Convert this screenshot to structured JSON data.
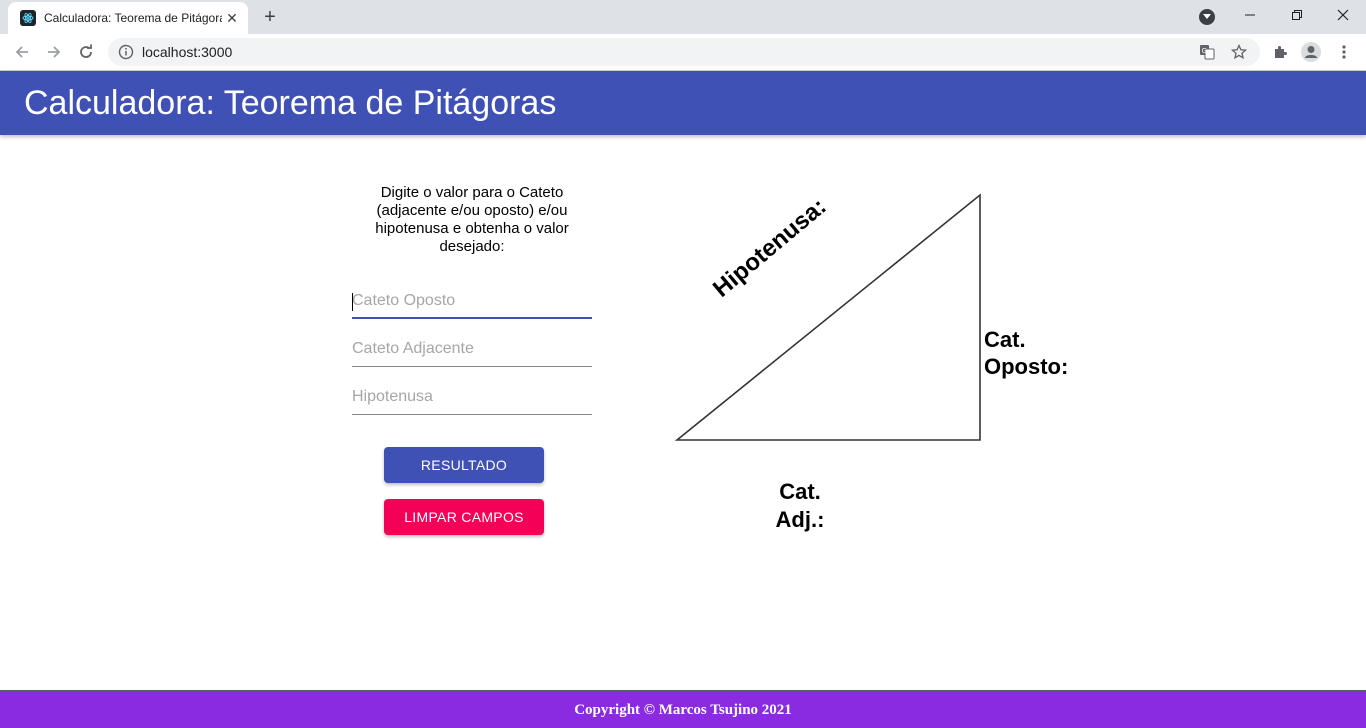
{
  "browser": {
    "tab_title": "Calculadora: Teorema de Pitágoras",
    "close_glyph": "✕",
    "newtab_glyph": "+",
    "url": "localhost:3000"
  },
  "app": {
    "title": "Calculadora: Teorema de Pitágoras",
    "instructions": "Digite o valor para o Cateto (adjacente e/ou oposto) e/ou hipotenusa e obtenha o valor desejado:",
    "fields": {
      "cateto_oposto": {
        "placeholder": "Cateto Oposto",
        "value": ""
      },
      "cateto_adjacente": {
        "placeholder": "Cateto Adjacente",
        "value": ""
      },
      "hipotenusa": {
        "placeholder": "Hipotenusa",
        "value": ""
      }
    },
    "buttons": {
      "resultado": "RESULTADO",
      "limpar": "LIMPAR CAMPOS"
    },
    "diagram": {
      "hipotenusa_label": "Hipotenusa:",
      "oposto_label_line1": "Cat.",
      "oposto_label_line2": "Oposto:",
      "adjacente_label_line1": "Cat.",
      "adjacente_label_line2": "Adj.:"
    },
    "footer": "Copyright © Marcos Tsujino 2021"
  },
  "colors": {
    "primary": "#3f51b5",
    "secondary": "#f50057",
    "footer": "#8a2be2"
  }
}
